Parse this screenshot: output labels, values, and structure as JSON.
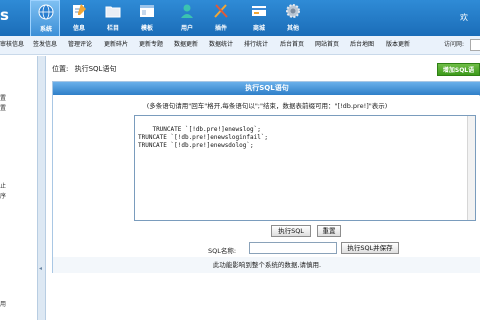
{
  "topbar": {
    "logo_text": "s",
    "right_text": "欢",
    "nav": [
      {
        "label": "系统",
        "icon": "globe-icon",
        "active": true
      },
      {
        "label": "信息",
        "icon": "pencil-note-icon",
        "active": false
      },
      {
        "label": "栏目",
        "icon": "folder-icon",
        "active": false
      },
      {
        "label": "模板",
        "icon": "template-window-icon",
        "active": false
      },
      {
        "label": "用户",
        "icon": "user-icon",
        "active": false
      },
      {
        "label": "插件",
        "icon": "tools-icon",
        "active": false
      },
      {
        "label": "商城",
        "icon": "card-icon",
        "active": false
      },
      {
        "label": "其他",
        "icon": "gear-icon",
        "active": false
      }
    ]
  },
  "menubar": {
    "links": [
      "审核信息",
      "签发信息",
      "管理评论",
      "更新碎片",
      "更新专题",
      "数据更新",
      "数据统计",
      "排行统计",
      "后台首页",
      "网站首页",
      "后台地图",
      "版本更新"
    ],
    "visit_label": "访问网:",
    "visit_value": ""
  },
  "sidebar": {
    "fragments": [
      "置",
      "置",
      "止",
      "序",
      "用"
    ]
  },
  "breadcrumb": {
    "prefix": "位置:",
    "link": "执行SQL语句"
  },
  "add_sql_button": "增加SQL语",
  "panel": {
    "title": "执行SQL语句",
    "hint": "(多条语句请用\"回车\"格开,每条语句以\";\"结束，数据表前缀可用：\"[!db.pre!]\"表示)",
    "sql_text": "TRUNCATE `[!db.pre!]enewslog`;\nTRUNCATE `[!db.pre!]enewsloginfail`;\nTRUNCATE `[!db.pre!]enewsdolog`;",
    "execute_button": "执行SQL",
    "reset_button": "重置",
    "sql_name_label": "SQL名称:",
    "sql_name_value": "",
    "execute_save_button": "执行SQL并保存",
    "note": "此功能影响到整个系统的数据,请慎用."
  },
  "colors": {
    "topbar": "#1b6db8",
    "panel_header": "#2f7fc8",
    "add_button": "#3d9a1b"
  }
}
